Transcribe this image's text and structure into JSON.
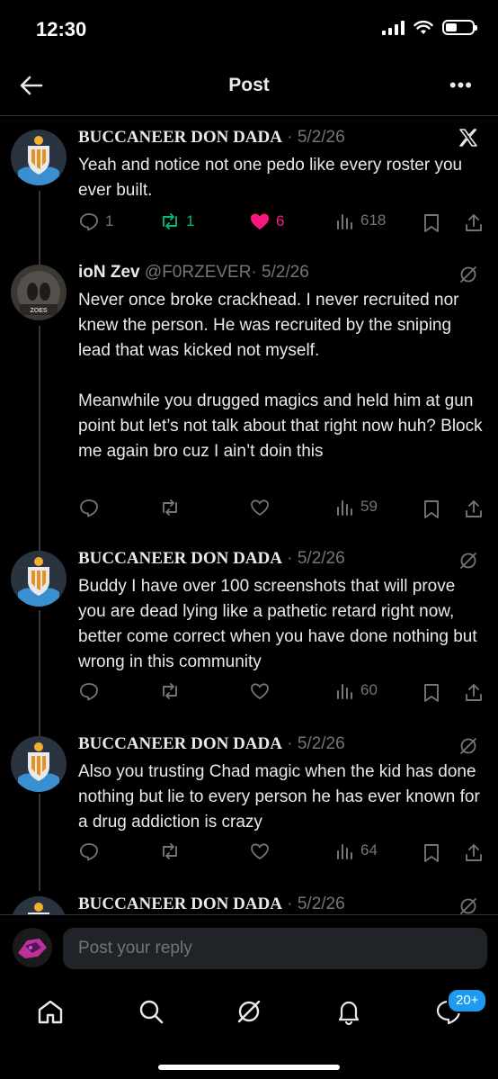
{
  "status_bar": {
    "time": "12:30"
  },
  "header": {
    "title": "Post",
    "back_icon": "arrow-left-icon",
    "more_icon": "more-horizontal-icon"
  },
  "posts": [
    {
      "name": "BUCCANEER DON DADA",
      "handle": "",
      "date": "5/2/26",
      "dot": "·",
      "text": "Yeah and notice not one pedo like every roster you ever built.",
      "replies": "1",
      "reposts": "1",
      "likes": "6",
      "views": "618"
    },
    {
      "name": "ioN Zev",
      "handle": "@F0RZEVER",
      "date": "5/2/26",
      "dot": "·",
      "text": "Never once broke crackhead. I never recruited nor knew the person. He was recruited by the sniping lead that was kicked not myself.",
      "text2": "Meanwhile you drugged magics and held him at gun point but let’s not talk about that right now  huh? Block me again bro cuz I ain’t doin this",
      "views": "59"
    },
    {
      "name": "BUCCANEER DON DADA",
      "date": "5/2/26",
      "dot": "·",
      "text": "Buddy I have over 100 screenshots that will prove you are dead lying like a pathetic retard right now, better come correct when you have done nothing but wrong in this community",
      "views": "60"
    },
    {
      "name": "BUCCANEER DON DADA",
      "date": "5/2/26",
      "dot": "·",
      "text": "Also you trusting Chad magic when the kid has done nothing but lie to every person he has ever known for a drug addiction is crazy",
      "views": "64"
    },
    {
      "name": "BUCCANEER DON DADA",
      "date": "5/2/26",
      "dot": "·"
    }
  ],
  "reply": {
    "placeholder": "Post your reply"
  },
  "tabs": [
    "home-icon",
    "search-icon",
    "grok-icon",
    "notifications-icon",
    "messages-icon"
  ],
  "messages_badge": "20+",
  "colors": {
    "background": "#000000",
    "text": "#e7e9ea",
    "muted": "#71767b",
    "repost": "#00ba7c",
    "like": "#f91880",
    "accent": "#1d9bf0"
  }
}
